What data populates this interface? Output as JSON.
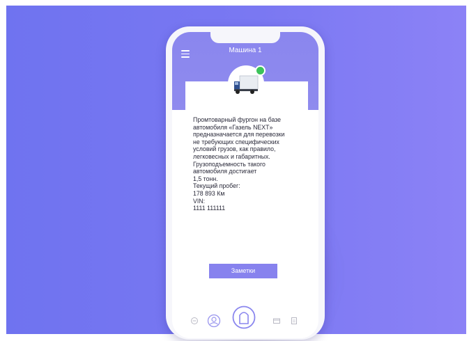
{
  "header": {
    "title": "Машина 1"
  },
  "vehicle": {
    "description_lines": [
      "Промтоварный фургон на базе",
      "автомобиля «Газель NEXT»",
      "предназначается для перевозки",
      "не требующих специфических",
      "условий грузов, как правило,",
      "легковесных и габаритных.",
      "Грузоподъемность такого",
      "автомобиля достигает",
      "1,5 тонн."
    ],
    "mileage_label": "Текущий пробег:",
    "mileage_value": "178 893 Км",
    "vin_label": "VIN:",
    "vin_value": "1111 111111",
    "status": "online"
  },
  "actions": {
    "notes_button": "Заметки"
  },
  "nav": {
    "icons": [
      "chat-icon",
      "profile-icon",
      "home-icon",
      "wallet-icon",
      "document-icon"
    ]
  },
  "colors": {
    "background": "#7a78f2",
    "accent": "#8782ee",
    "status_online": "#3cc35a"
  }
}
